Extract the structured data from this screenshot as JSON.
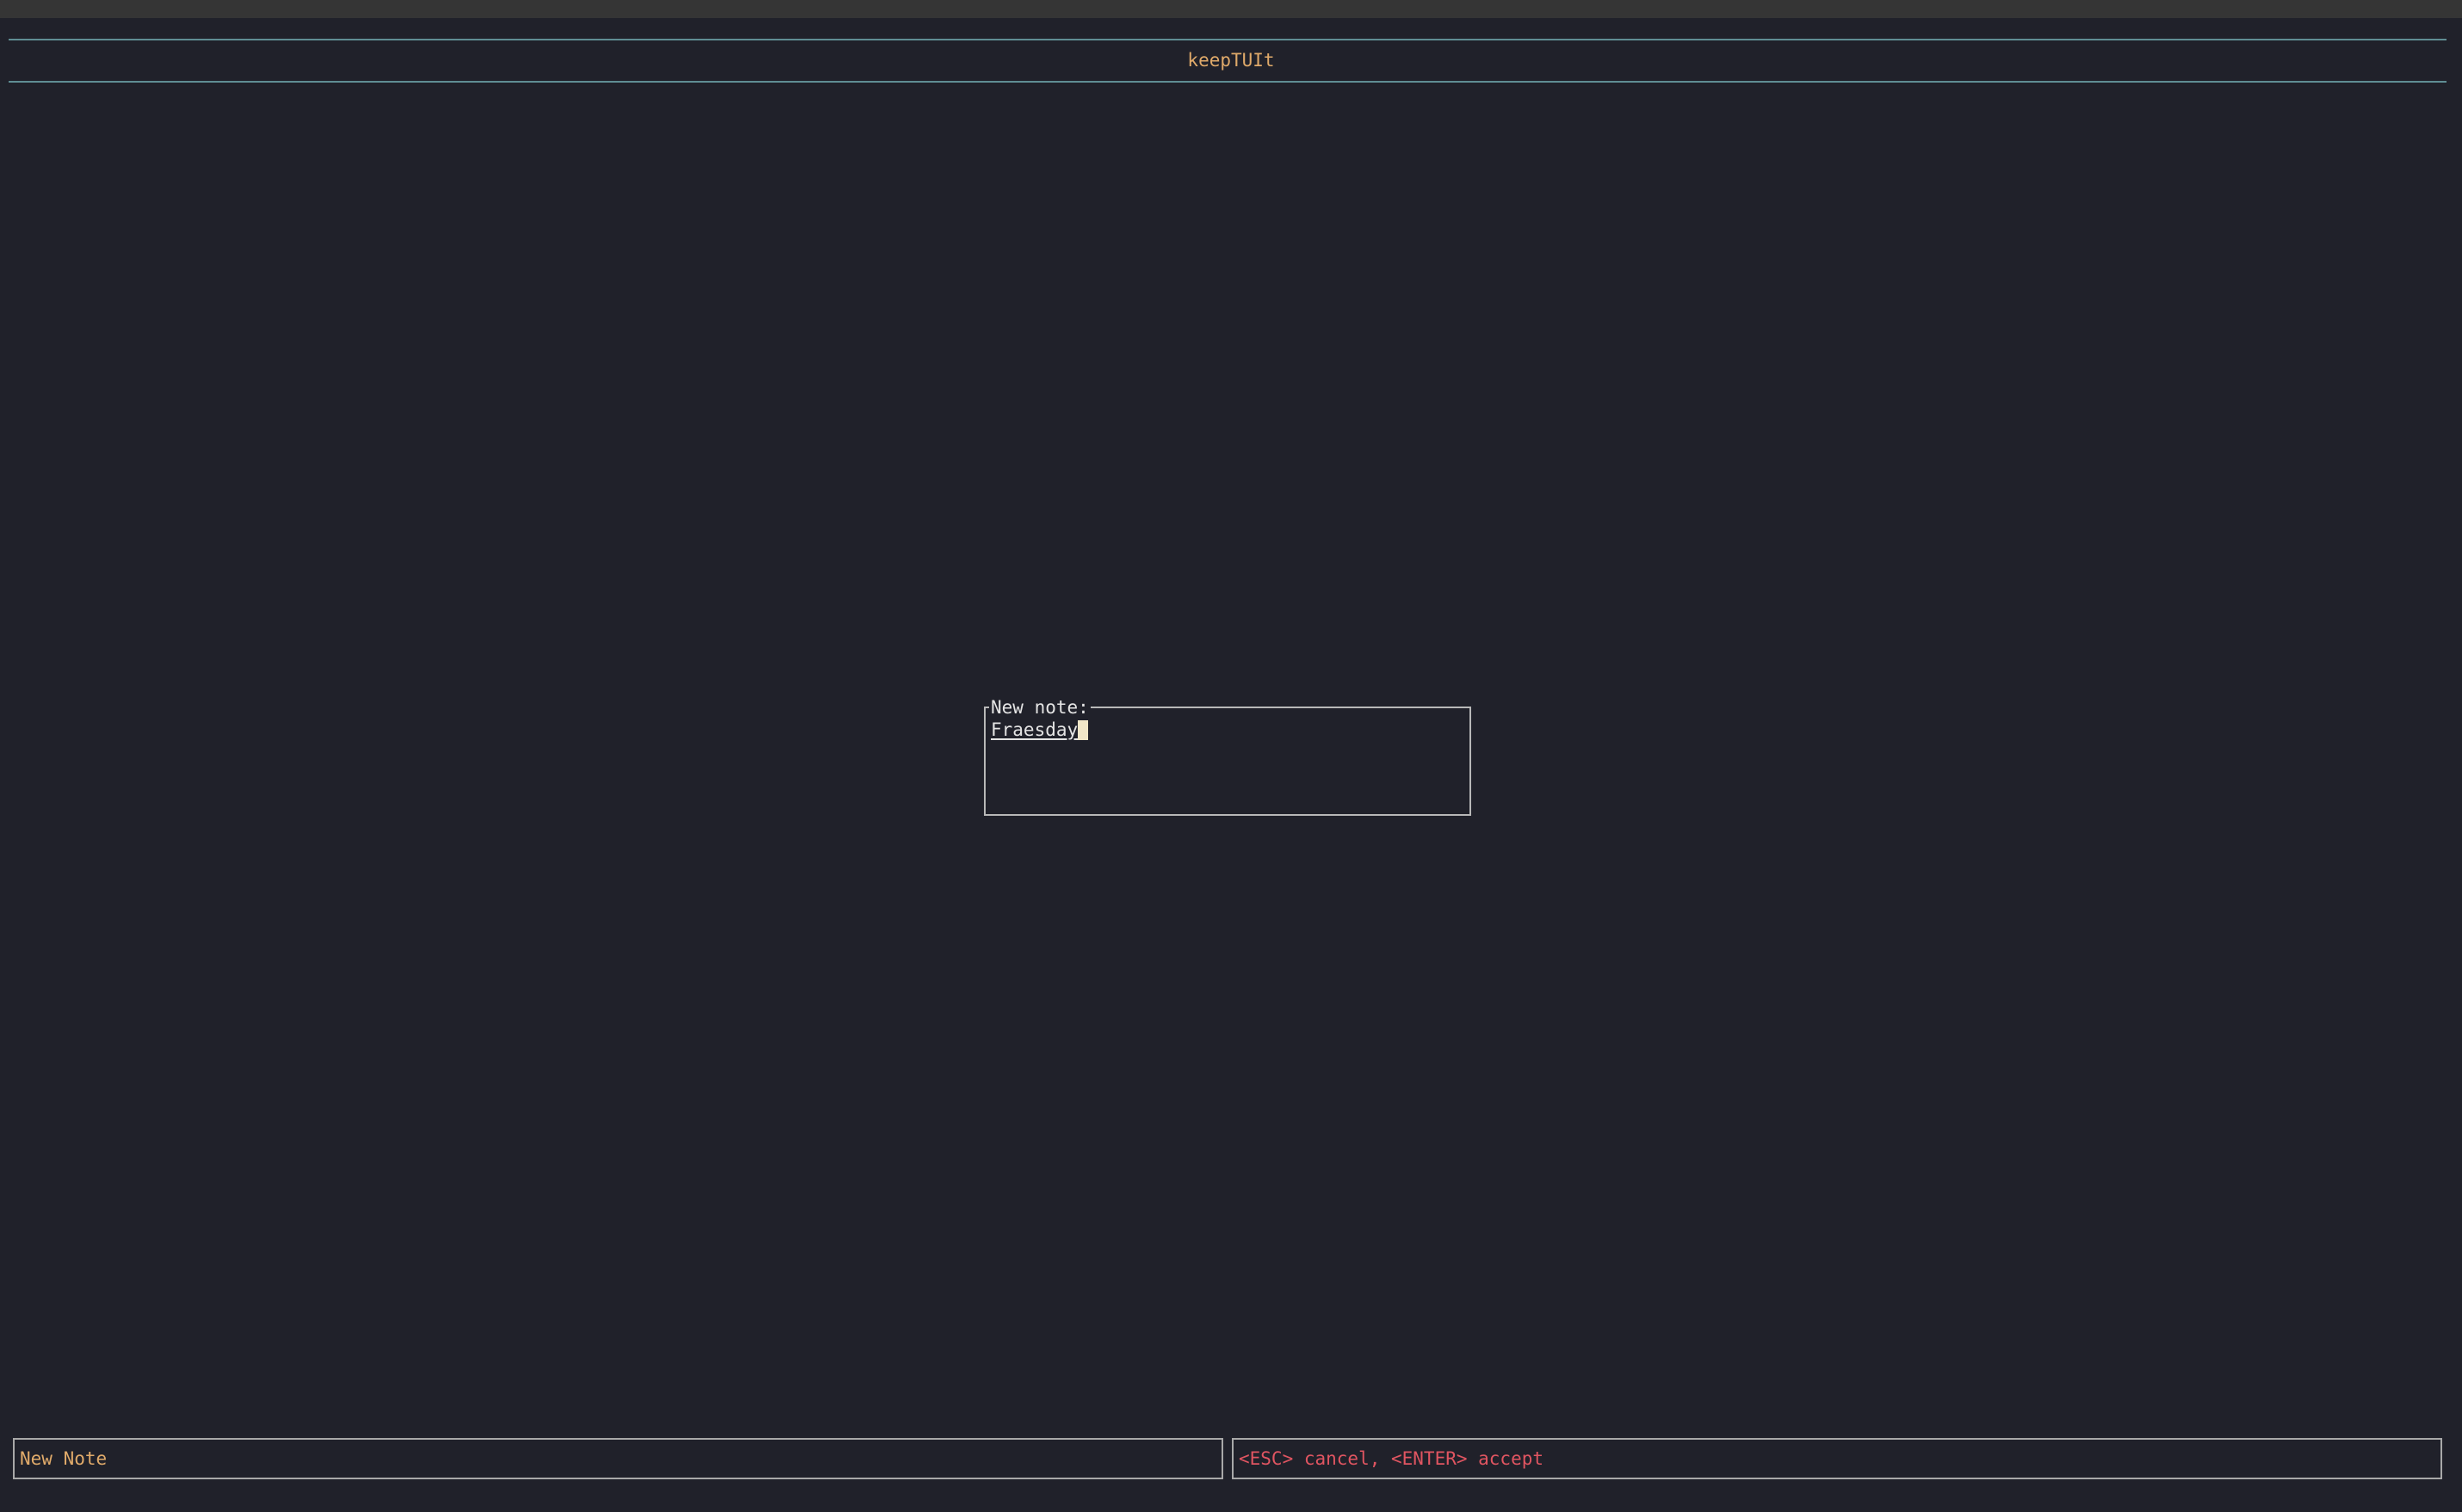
{
  "app": {
    "title": "keepTUIt"
  },
  "dialog": {
    "label": "New note:",
    "value": "Fraesday"
  },
  "statusbar": {
    "mode": "New Note",
    "hint": "<ESC> cancel, <ENTER> accept"
  },
  "colors": {
    "background": "#20212a",
    "title_accent": "#e0aa6a",
    "title_rule": "#5f8d93",
    "hint_text": "#e05561",
    "cursor": "#f0e6c8"
  }
}
